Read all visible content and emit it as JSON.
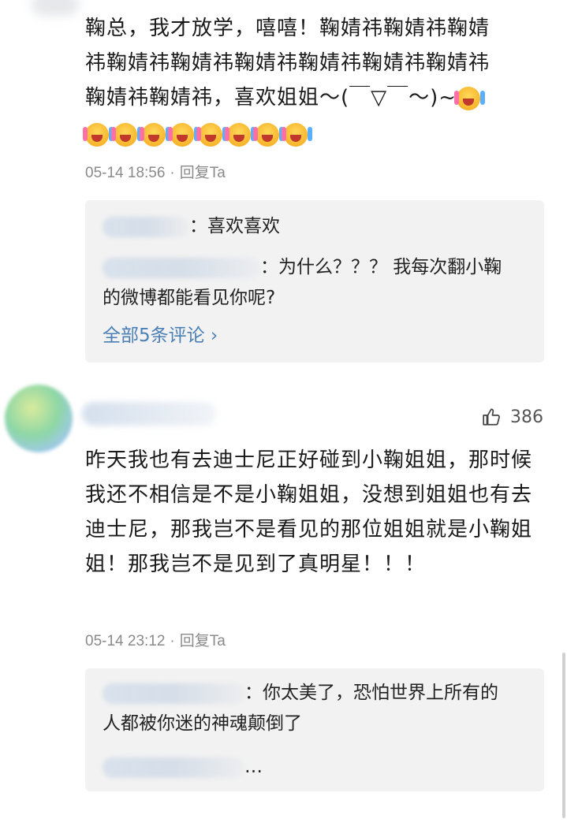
{
  "comments": [
    {
      "text_line1": "鞠总，我才放学，嘻嘻！鞠婧祎鞠婧祎鞠婧",
      "text_line2": "祎鞠婧祎鞠婧祎鞠婧祎鞠婧祎鞠婧祎鞠婧祎",
      "text_line3": "鞠婧祎鞠婧祎，喜欢姐姐～(￣▽￣～)~",
      "time": "05-14 18:56",
      "reply_label": "回复Ta",
      "replies": [
        {
          "text": "：喜欢喜欢"
        },
        {
          "text": "：为什么？？？ 我每次翻小鞠",
          "text_cont": "的微博都能看见你呢?"
        }
      ],
      "see_all": "全部5条评论 ›"
    },
    {
      "like_count": "386",
      "text": "昨天我也有去迪士尼正好碰到小鞠姐姐，那时候我还不相信是不是小鞠姐姐，没想到姐姐也有去迪士尼，那我岂不是看见的那位姐姐就是小鞠姐姐！那我岂不是见到了真明星！！！",
      "time": "05-14 23:12",
      "reply_label": "回复Ta",
      "replies": [
        {
          "text": "：你太美了，恐怕世界上所有的",
          "text_cont": "人都被你迷的神魂颠倒了"
        },
        {
          "text": "…"
        }
      ]
    }
  ],
  "icons": {
    "emoji": "laughing-emoji-icon",
    "like": "thumbs-up-icon"
  }
}
